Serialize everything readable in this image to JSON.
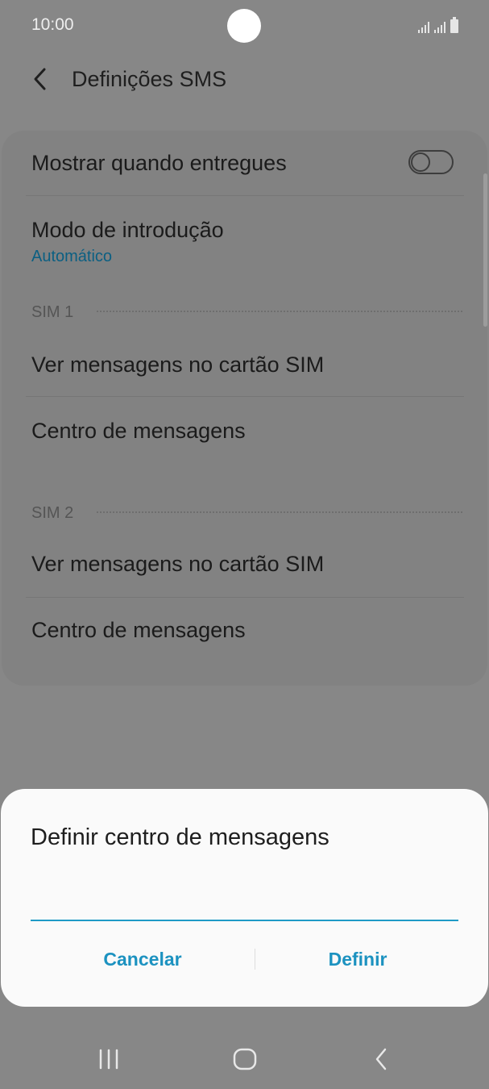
{
  "status_bar": {
    "time": "10:00",
    "icons": [
      "signal-sim1-icon",
      "signal-sim2-icon",
      "battery-icon"
    ]
  },
  "app_bar": {
    "back_icon": "chevron-left-icon",
    "title": "Definições SMS"
  },
  "settings": {
    "delivery_reports": {
      "label": "Mostrar quando entregues",
      "enabled": false
    },
    "input_mode": {
      "label": "Modo de introdução",
      "value": "Automático"
    },
    "sim1": {
      "header": "SIM 1",
      "view_messages": "Ver mensagens no cartão SIM",
      "message_center": "Centro de mensagens"
    },
    "sim2": {
      "header": "SIM 2",
      "view_messages": "Ver mensagens no cartão SIM",
      "message_center": "Centro de mensagens"
    }
  },
  "dialog": {
    "title": "Definir centro de mensagens",
    "input_value": "",
    "cancel_label": "Cancelar",
    "confirm_label": "Definir"
  },
  "colors": {
    "accent": "#1c92c0",
    "scrim": "#878787",
    "dialog_bg": "#fafafa"
  },
  "nav_bar": {
    "recents_icon": "recents-icon",
    "home_icon": "home-icon",
    "back_icon": "back-icon"
  }
}
